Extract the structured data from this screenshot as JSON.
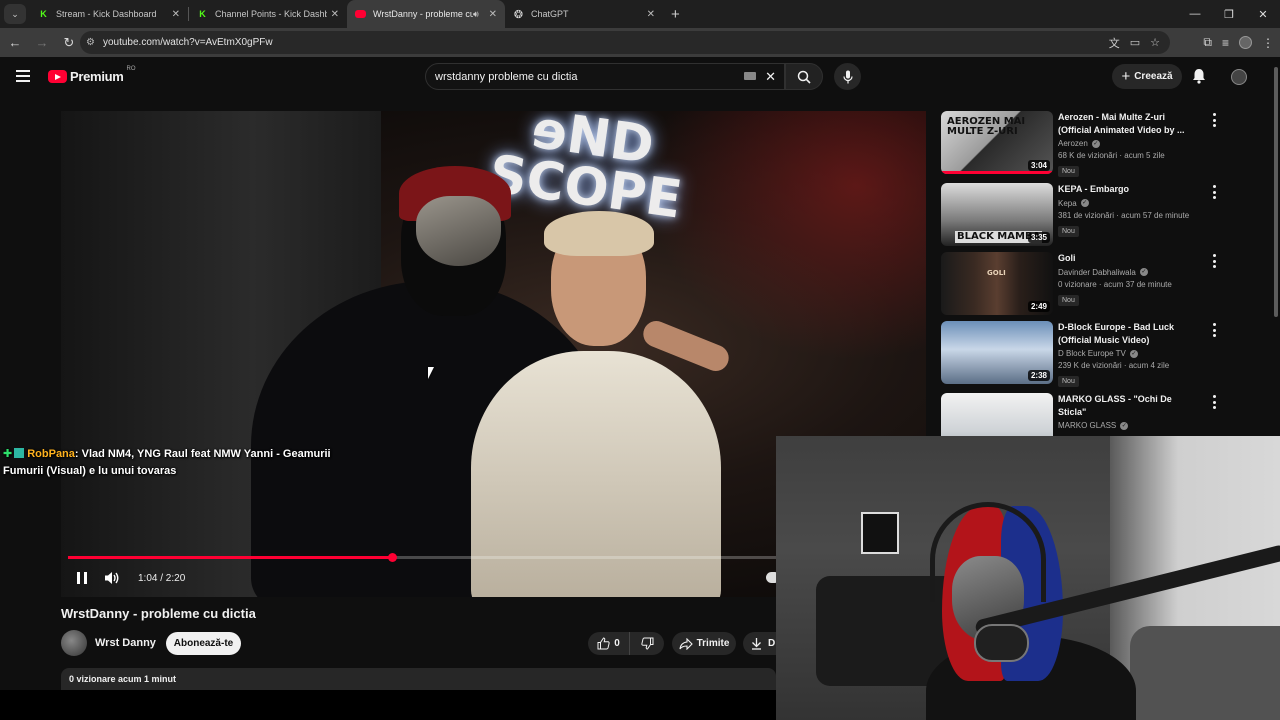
{
  "browser": {
    "tabs": [
      {
        "label": "Stream - Kick Dashboard",
        "favicon": "kick-icon",
        "active": false
      },
      {
        "label": "Channel Points - Kick Dashboard",
        "favicon": "kick-icon",
        "active": false
      },
      {
        "label": "WrstDanny - probleme cu dictia",
        "favicon": "youtube-icon",
        "active": true,
        "audio": true
      },
      {
        "label": "ChatGPT",
        "favicon": "chatgpt-icon",
        "active": false
      }
    ],
    "url": "youtube.com/watch?v=AvEtmX0gPFw"
  },
  "header": {
    "brand": "Premium",
    "country": "RO",
    "search_value": "wrstdanny probleme cu dictia",
    "create_label": "Creează"
  },
  "player": {
    "current_time": "1:04",
    "duration": "2:20",
    "time_display": "1:04 / 2:20",
    "progress_fraction": 0.457,
    "chat_overlay": {
      "user": "RobPana",
      "message": ": Vlad NM4, YNG Raul feat NMW Yanni - Geamurii Fumurii (Visual) e lu unui tovaras"
    }
  },
  "video": {
    "title": "WrstDanny - probleme cu dictia",
    "channel": "Wrst Danny",
    "subscribe_label": "Abonează-te",
    "likes": "0",
    "share_label": "Trimite",
    "download_label": "D",
    "description_meta": "0 vizionare  acum 1 minut"
  },
  "recommendations": [
    {
      "title": "Aerozen - Mai Multe Z-uri (Official Animated Video by ...",
      "channel": "Aerozen",
      "verified": true,
      "meta": "68 K de vizionări · acum 5 zile",
      "badge": "Nou",
      "duration": "3:04",
      "thumb_text": "AEROZEN MAI MULTE Z-URI",
      "watched_fraction": 1.0
    },
    {
      "title": "KEPA - Embargo",
      "channel": "Kepa",
      "verified": true,
      "meta": "381 de vizionări · acum 57 de minute",
      "badge": "Nou",
      "duration": "3:35",
      "thumb_text": "BLACK MAMBA",
      "watched_fraction": 0
    },
    {
      "title": "Goli",
      "channel": "Davinder Dabhaliwala",
      "verified": true,
      "meta": "0 vizionare · acum 37 de minute",
      "badge": "Nou",
      "duration": "2:49",
      "thumb_text": "GOLI",
      "watched_fraction": 0
    },
    {
      "title": "D-Block Europe - Bad Luck (Official Music Video)",
      "channel": "D Block Europe TV",
      "verified": true,
      "meta": "239 K de vizionări · acum 4 zile",
      "badge": "Nou",
      "duration": "2:38",
      "thumb_text": "",
      "watched_fraction": 0
    },
    {
      "title": "MARKO GLASS - \"Ochi De Sticla\"",
      "channel": "MARKO GLASS",
      "verified": true,
      "meta": "",
      "badge": "",
      "duration": "",
      "thumb_text": "",
      "watched_fraction": 0
    }
  ],
  "colors": {
    "youtube_red": "#ff0033",
    "kick_green": "#53fc18",
    "chat_username": "#ffb21e"
  }
}
